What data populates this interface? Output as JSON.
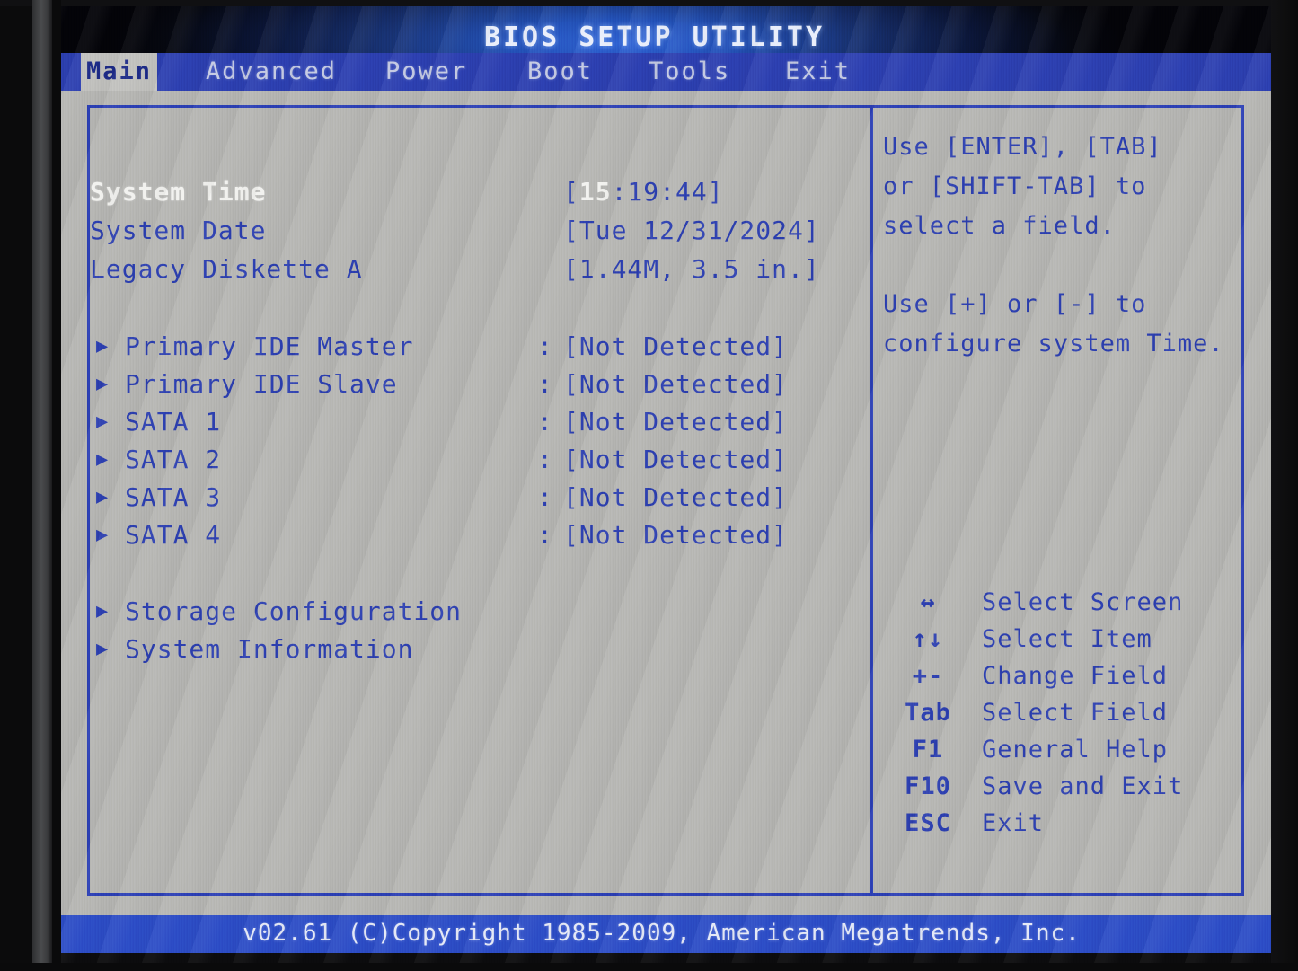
{
  "header": {
    "title": "BIOS SETUP UTILITY",
    "tabs": [
      {
        "label": "Main",
        "active": true
      },
      {
        "label": "Advanced",
        "active": false
      },
      {
        "label": "Power",
        "active": false
      },
      {
        "label": "Boot",
        "active": false
      },
      {
        "label": "Tools",
        "active": false
      },
      {
        "label": "Exit",
        "active": false
      }
    ]
  },
  "main": {
    "fields": [
      {
        "label": "System Time",
        "value_prefix": "[",
        "value_highlight": "15",
        "value_rest": ":19:44]",
        "selected": true
      },
      {
        "label": "System Date",
        "value": "[Tue 12/31/2024]",
        "selected": false
      },
      {
        "label": "Legacy Diskette A",
        "value": "[1.44M, 3.5 in.]",
        "selected": false
      }
    ],
    "drives": [
      {
        "arrow": "▶",
        "label": "Primary IDE Master",
        "colon": ":",
        "value": "[Not Detected]"
      },
      {
        "arrow": "▶",
        "label": "Primary IDE Slave",
        "colon": ":",
        "value": "[Not Detected]"
      },
      {
        "arrow": "▶",
        "label": "SATA 1",
        "colon": ":",
        "value": "[Not Detected]"
      },
      {
        "arrow": "▶",
        "label": "SATA 2",
        "colon": ":",
        "value": "[Not Detected]"
      },
      {
        "arrow": "▶",
        "label": "SATA 3",
        "colon": ":",
        "value": "[Not Detected]"
      },
      {
        "arrow": "▶",
        "label": "SATA 4",
        "colon": ":",
        "value": "[Not Detected]"
      }
    ],
    "submenus": [
      {
        "arrow": "▶",
        "label": "Storage Configuration"
      },
      {
        "arrow": "▶",
        "label": "System Information"
      }
    ]
  },
  "help": {
    "lines": [
      "Use [ENTER], [TAB]",
      "or [SHIFT-TAB] to",
      "select a field.",
      "",
      "Use [+] or [-] to",
      "configure system Time."
    ]
  },
  "legend": [
    {
      "key": "↔",
      "desc": "Select Screen"
    },
    {
      "key": "↑↓",
      "desc": "Select Item"
    },
    {
      "key": "+-",
      "desc": "Change Field"
    },
    {
      "key": "Tab",
      "desc": "Select Field"
    },
    {
      "key": "F1",
      "desc": "General Help"
    },
    {
      "key": "F10",
      "desc": "Save and Exit"
    },
    {
      "key": "ESC",
      "desc": "Exit"
    }
  ],
  "footer": {
    "text": "v02.61 (C)Copyright 1985-2009, American Megatrends, Inc."
  },
  "colors": {
    "accent_blue": "#2c3fb0",
    "menu_blue": "#2c3fb0",
    "footer_blue": "#2c4cc6",
    "screen_gray": "#b5b5b2",
    "selected_text": "#f2f2ef",
    "active_tab_bg": "#c0c0bd"
  }
}
